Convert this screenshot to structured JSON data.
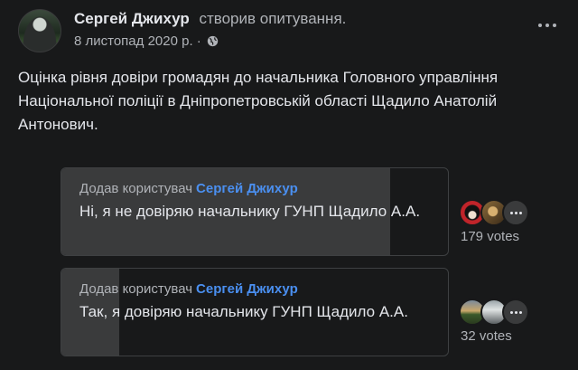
{
  "post": {
    "author": "Сергей Джихур",
    "action": "створив опитування.",
    "date": "8 листопад 2020 р. ·",
    "privacy_icon": "globe-icon",
    "text": "Оцінка рівня довіри громадян до начальника Головного управління Національної поліції в Дніпропетровській області Щадило Анатолій Антонович."
  },
  "poll": {
    "options": [
      {
        "added_by_label": "Додав користувач",
        "added_by_name": "Сергей Джихур",
        "text": "Ні, я не довіряю начальнику ГУНП Щадило А.А.",
        "votes": "179 votes",
        "share": 0.85
      },
      {
        "added_by_label": "Додав користувач",
        "added_by_name": "Сергей Джихур",
        "text": "Так, я довіряю начальнику ГУНП Щадило А.А.",
        "votes": "32 votes",
        "share": 0.15
      }
    ]
  },
  "colors": {
    "background": "#18191a",
    "text": "#e4e6eb",
    "secondary_text": "#b0b3b8",
    "link": "#4a8ff0",
    "fill": "#3a3b3c"
  }
}
